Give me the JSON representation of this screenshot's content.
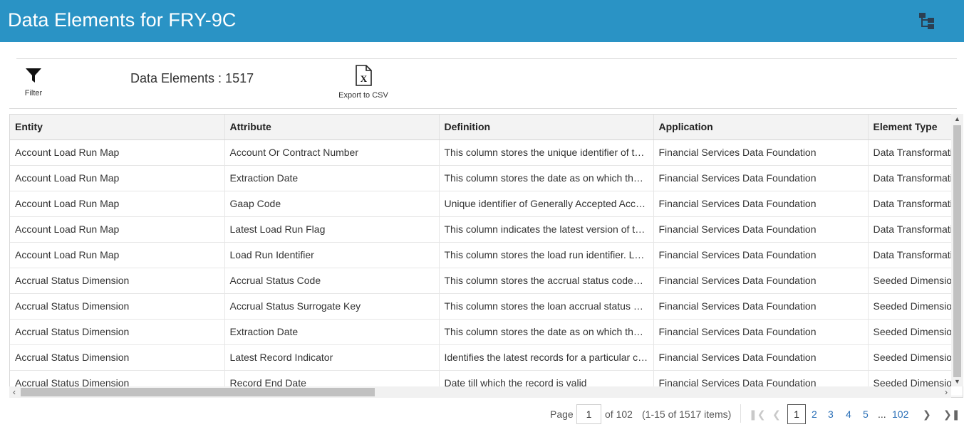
{
  "header": {
    "title": "Data Elements for FRY-9C",
    "hierarchy_icon": "hierarchy-icon"
  },
  "toolbar": {
    "filter_label": "Filter",
    "count_text": "Data Elements : 1517",
    "export_label": "Export to CSV"
  },
  "table": {
    "columns": [
      "Entity",
      "Attribute",
      "Definition",
      "Application",
      "Element Type"
    ],
    "rows": [
      [
        "Account Load Run Map",
        "Account Or Contract Number",
        "This column stores the unique identifier of th...",
        "Financial Services Data Foundation",
        "Data Transformati"
      ],
      [
        "Account Load Run Map",
        "Extraction Date",
        "This column stores the date as on which the ...",
        "Financial Services Data Foundation",
        "Data Transformati"
      ],
      [
        "Account Load Run Map",
        "Gaap Code",
        "Unique identifier of Generally Accepted Acco...",
        "Financial Services Data Foundation",
        "Data Transformati"
      ],
      [
        "Account Load Run Map",
        "Latest Load Run Flag",
        "This column indicates the latest version of th...",
        "Financial Services Data Foundation",
        "Data Transformati"
      ],
      [
        "Account Load Run Map",
        "Load Run Identifier",
        "This column stores the load run identifier. Lo...",
        "Financial Services Data Foundation",
        "Data Transformati"
      ],
      [
        "Accrual Status Dimension",
        "Accrual Status Code",
        "This column stores the accrual status codes. ...",
        "Financial Services Data Foundation",
        "Seeded Dimension"
      ],
      [
        "Accrual Status Dimension",
        "Accrual Status Surrogate Key",
        "This column stores the loan accrual status su...",
        "Financial Services Data Foundation",
        "Seeded Dimension"
      ],
      [
        "Accrual Status Dimension",
        "Extraction Date",
        "This column stores the date as on which the ...",
        "Financial Services Data Foundation",
        "Seeded Dimension"
      ],
      [
        "Accrual Status Dimension",
        "Latest Record Indicator",
        "Identifies the latest records for a particular co...",
        "Financial Services Data Foundation",
        "Seeded Dimension"
      ],
      [
        "Accrual Status Dimension",
        "Record End Date",
        "Date till which the record is valid",
        "Financial Services Data Foundation",
        "Seeded Dimension"
      ]
    ]
  },
  "pager": {
    "page_label": "Page",
    "current_page": "1",
    "of_text": "of 102",
    "items_text": "(1-15 of 1517 items)",
    "pages": [
      "1",
      "2",
      "3",
      "4",
      "5",
      "...",
      "102"
    ]
  }
}
